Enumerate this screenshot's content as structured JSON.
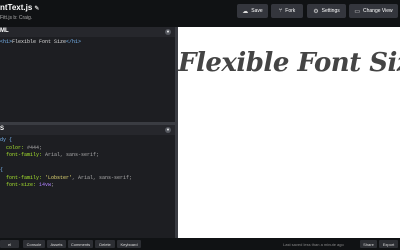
{
  "header": {
    "title": "ntText.js",
    "byline": "Fitt.js b: Craig.",
    "buttons": {
      "save": "Save",
      "fork": "Fork",
      "settings": "Settings",
      "change_view": "Change View"
    }
  },
  "html_panel": {
    "label": "ML",
    "code": {
      "open_tag": "<h1>",
      "text": "Flexible Font Size",
      "close_tag": "</h1>"
    }
  },
  "css_panel": {
    "label": "S",
    "lines": {
      "l1": "dy {",
      "l2_prop": "color:",
      "l2_val": " #444;",
      "l3_prop": "font-family:",
      "l3_val": " Arial, sans-serif;",
      "l5": "{",
      "l6_prop": "font-family:",
      "l6_str": " 'Lobster'",
      "l6_val": ", Arial, sans-serif;",
      "l7_prop": "font-size:",
      "l7_num": " 14vw",
      "l7_end": ";"
    }
  },
  "preview": {
    "heading": "Flexible Font Size"
  },
  "footer": {
    "left": "el",
    "buttons": {
      "console": "Console",
      "assets": "Assets",
      "comments": "Comments",
      "delete": "Delete",
      "keyboard": "Keyboard"
    },
    "saved_text": "Last saved less than a minute ago",
    "share": "Share",
    "export": "Export"
  },
  "colors": {
    "background": "#1d1e22",
    "header": "#101214",
    "button": "#34363d",
    "tag": "#79b6f2",
    "string": "#e6db74",
    "number": "#ae81ff"
  },
  "icons": {
    "save": "cloud-icon",
    "fork": "fork-icon",
    "settings": "gear-icon",
    "change_view": "layout-icon",
    "panel_toggle": "chevron-down-icon"
  }
}
